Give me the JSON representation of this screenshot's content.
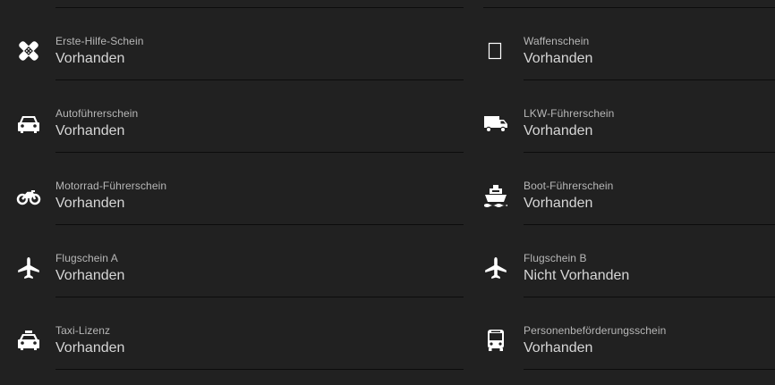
{
  "left_column": [
    {
      "icon": "bandage-icon",
      "label": "Erste-Hilfe-Schein",
      "value": "Vorhanden"
    },
    {
      "icon": "car-icon",
      "label": "Autoführerschein",
      "value": "Vorhanden"
    },
    {
      "icon": "motorcycle-icon",
      "label": "Motorrad-Führerschein",
      "value": "Vorhanden"
    },
    {
      "icon": "airplane-icon",
      "label": "Flugschein A",
      "value": "Vorhanden"
    },
    {
      "icon": "taxi-icon",
      "label": "Taxi-Lizenz",
      "value": "Vorhanden"
    }
  ],
  "right_column": [
    {
      "icon": "missing-glyph-icon",
      "label": "Waffenschein",
      "value": "Vorhanden"
    },
    {
      "icon": "truck-icon",
      "label": "LKW-Führerschein",
      "value": "Vorhanden"
    },
    {
      "icon": "ship-icon",
      "label": "Boot-Führerschein",
      "value": "Vorhanden"
    },
    {
      "icon": "airplane-icon",
      "label": "Flugschein B",
      "value": "Nicht Vorhanden"
    },
    {
      "icon": "bus-icon",
      "label": "Personenbeförderungsschein",
      "value": "Vorhanden"
    }
  ],
  "colors": {
    "background": "#212121",
    "label": "#b7b7b7",
    "value": "#d6d6d6",
    "icon": "#ffffff",
    "divider": "#0c0c0c"
  }
}
